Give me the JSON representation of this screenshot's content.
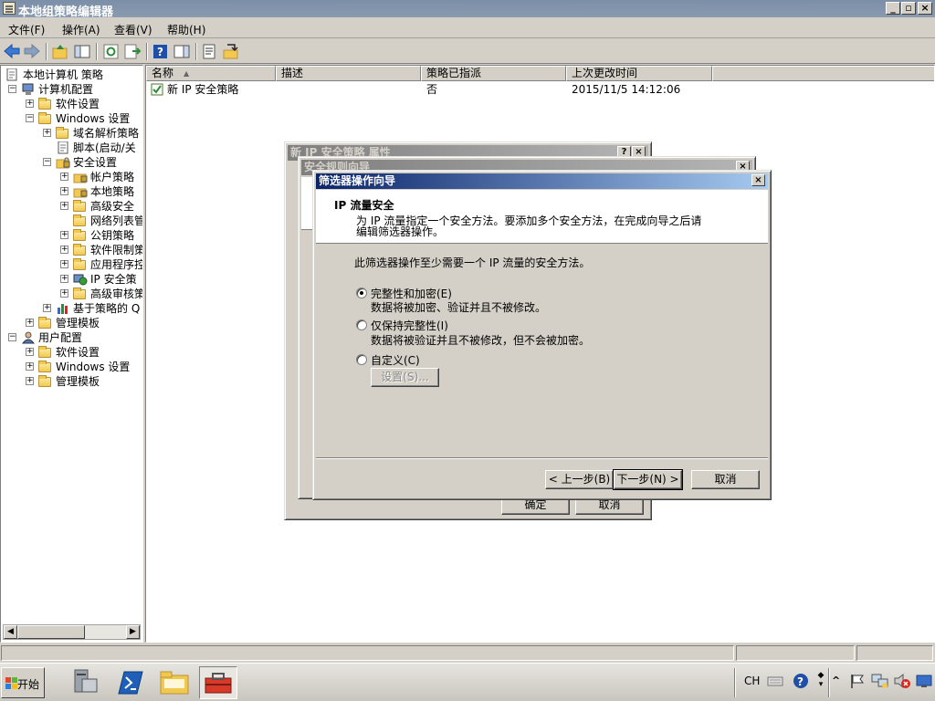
{
  "window": {
    "title": "本地组策略编辑器"
  },
  "menu": [
    "文件(F)",
    "操作(A)",
    "查看(V)",
    "帮助(H)"
  ],
  "tree": {
    "root": "本地计算机 策略",
    "items": [
      {
        "label": "计算机配置"
      },
      {
        "label": "软件设置"
      },
      {
        "label": "Windows 设置"
      },
      {
        "label": "域名解析策略"
      },
      {
        "label": "脚本(启动/关"
      },
      {
        "label": "安全设置"
      },
      {
        "label": "帐户策略"
      },
      {
        "label": "本地策略"
      },
      {
        "label": "高级安全"
      },
      {
        "label": "网络列表管"
      },
      {
        "label": "公钥策略"
      },
      {
        "label": "软件限制策"
      },
      {
        "label": "应用程序控"
      },
      {
        "label": "IP 安全策"
      },
      {
        "label": "高级审核策"
      },
      {
        "label": "基于策略的 Q"
      },
      {
        "label": "管理模板"
      },
      {
        "label": "用户配置"
      },
      {
        "label": "软件设置"
      },
      {
        "label": "Windows 设置"
      },
      {
        "label": "管理模板"
      }
    ]
  },
  "list": {
    "columns": [
      "名称",
      "描述",
      "策略已指派",
      "上次更改时间"
    ],
    "rows": [
      {
        "name": "新 IP 安全策略",
        "description": "",
        "assigned": "否",
        "modified": "2015/11/5 14:12:06"
      }
    ]
  },
  "back_dialogs": {
    "properties_title": "新 IP 安全策略 属性",
    "rule_wizard_title": "安全规则向导",
    "ok_label": "确定",
    "cancel_label": "取消"
  },
  "wizard": {
    "title": "筛选器操作向导",
    "header_title": "IP 流量安全",
    "header_desc_line1": "为 IP 流量指定一个安全方法。要添加多个安全方法，在完成向导之后请",
    "header_desc_line2": "编辑筛选器操作。",
    "prompt": "此筛选器操作至少需要一个 IP 流量的安全方法。",
    "options": [
      {
        "label": "完整性和加密(E)",
        "desc": "数据将被加密、验证并且不被修改。",
        "selected": true
      },
      {
        "label": "仅保持完整性(I)",
        "desc": "数据将被验证并且不被修改，但不会被加密。",
        "selected": false
      },
      {
        "label": "自定义(C)",
        "desc": "",
        "selected": false
      }
    ],
    "settings_button": "设置(S)...",
    "back_button": "< 上一步(B)",
    "next_button": "下一步(N) >",
    "cancel_button": "取消"
  },
  "taskbar": {
    "start_label": "开始",
    "tray_lang": "CH"
  },
  "colors": {
    "active_caption": "#0a246a",
    "inactive_caption": "#7f7f7f",
    "face": "#d4d0c8"
  }
}
